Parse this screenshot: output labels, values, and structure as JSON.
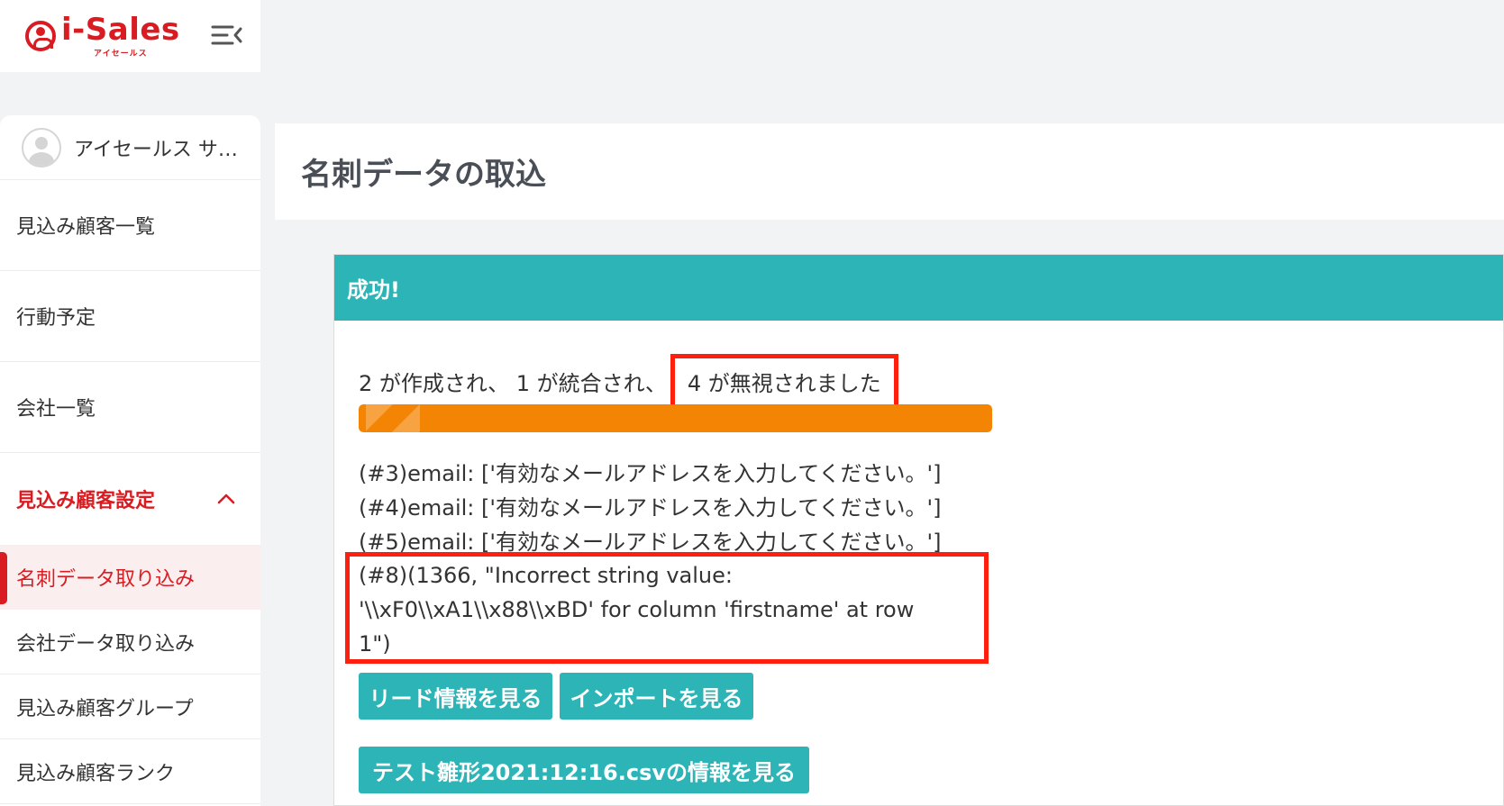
{
  "logo": {
    "brand": "i-Sales",
    "sub": "アイセールス"
  },
  "user": {
    "name": "アイセールス サ…"
  },
  "nav": {
    "items": [
      "見込み顧客一覧",
      "行動予定",
      "会社一覧"
    ],
    "section": "見込み顧客設定",
    "sub_items": [
      "名刺データ取り込み",
      "会社データ取り込み",
      "見込み顧客グループ",
      "見込み顧客ランク"
    ]
  },
  "page": {
    "title": "名刺データの取込"
  },
  "result": {
    "header": "成功!",
    "summary_main": "2 が作成され、 1 が統合され、",
    "summary_highlight": "4 が無視されました",
    "progress_fraction": 1.0,
    "errors": [
      "(#3)email: ['有効なメールアドレスを入力してください。']",
      "(#4)email: ['有効なメールアドレスを入力してください。']",
      "(#5)email: ['有効なメールアドレスを入力してください。']"
    ],
    "error_highlight_lines": [
      "(#8)(1366, \"Incorrect string value:",
      "'\\\\xF0\\\\xA1\\\\x88\\\\xBD' for column 'firstname' at row",
      "1\")"
    ]
  },
  "buttons": {
    "view_leads": "リード情報を見る",
    "view_import": "インポートを見る",
    "view_file": "テスト雛形2021:12:16.csvの情報を見る"
  },
  "colors": {
    "brand_red": "#d81c22",
    "teal": "#2cb4b6",
    "orange": "#f48403",
    "highlight_red": "#ff1f0f"
  }
}
